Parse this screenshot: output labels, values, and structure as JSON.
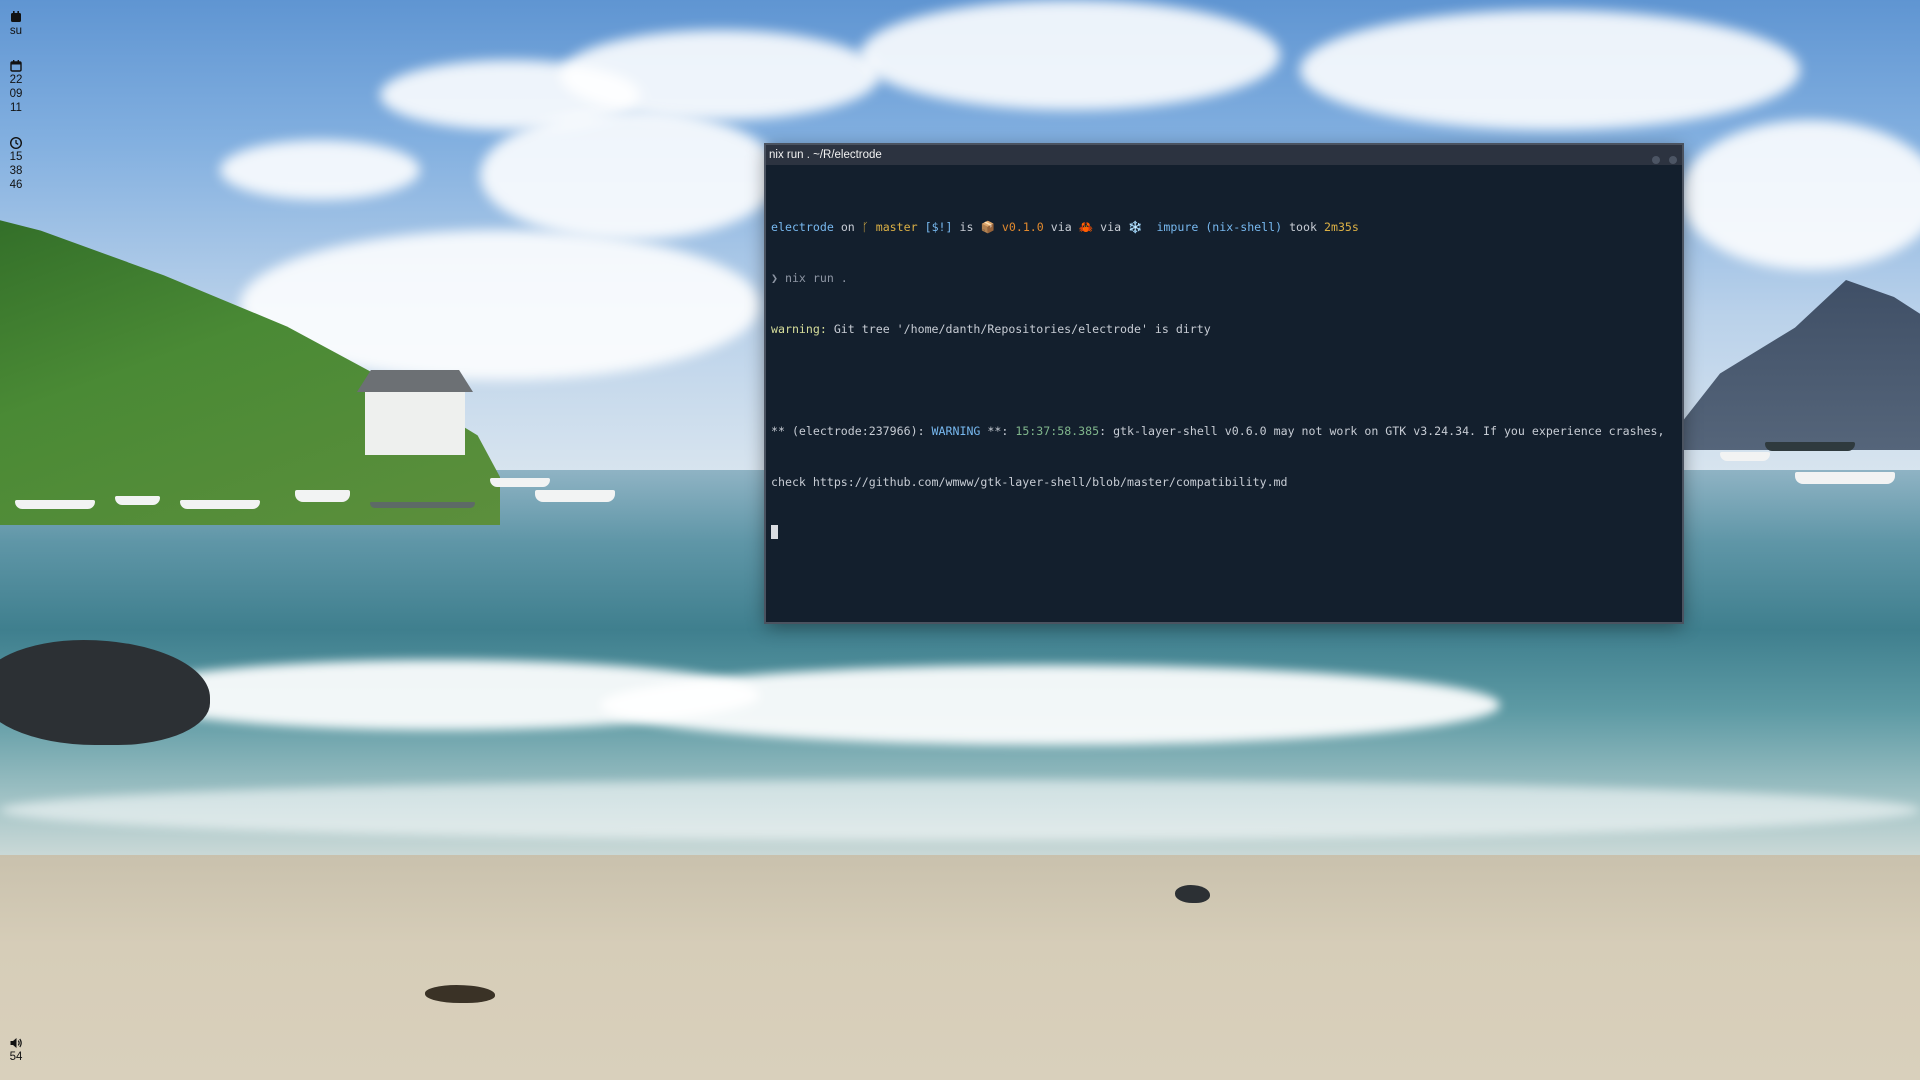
{
  "sidebar": {
    "day_label": "su",
    "date": [
      "22",
      "09",
      "11"
    ],
    "time": [
      "15",
      "38",
      "46"
    ],
    "volume": "54"
  },
  "window": {
    "title": "nix run . ~/R/electrode",
    "terminal": {
      "prompt": {
        "dir": "electrode",
        "on": "on",
        "branch_icon": "ᚴ",
        "branch": "master",
        "status": "[$!]",
        "is": "is",
        "package_icon": "📦",
        "version": "v0.1.0",
        "via1": "via",
        "rust_icon": "🦀",
        "via2": "via",
        "nix_icon": "❄️",
        "impure": "impure (nix-shell)",
        "took": "took",
        "duration": "2m35s"
      },
      "command_prompt": "❯",
      "command": "nix run .",
      "warning_label": "warning:",
      "warning_text": "Git tree '/home/danth/Repositories/electrode' is dirty",
      "log_prefix": "** (electrode:237966):",
      "log_level": "WARNING",
      "log_sep": "**:",
      "log_time": "15:37:58.385",
      "log_message": ": gtk-layer-shell v0.6.0 may not work on GTK v3.24.34. If you experience crashes,",
      "log_line2": "check https://github.com/wmww/gtk-layer-shell/blob/master/compatibility.md"
    }
  },
  "colors": {
    "terminal_bg": "#131f2d",
    "titlebar_bg": "#2c3340",
    "prompt_blue": "#77b8ef",
    "prompt_gold": "#dbb045",
    "prompt_orange": "#e28a2e"
  }
}
